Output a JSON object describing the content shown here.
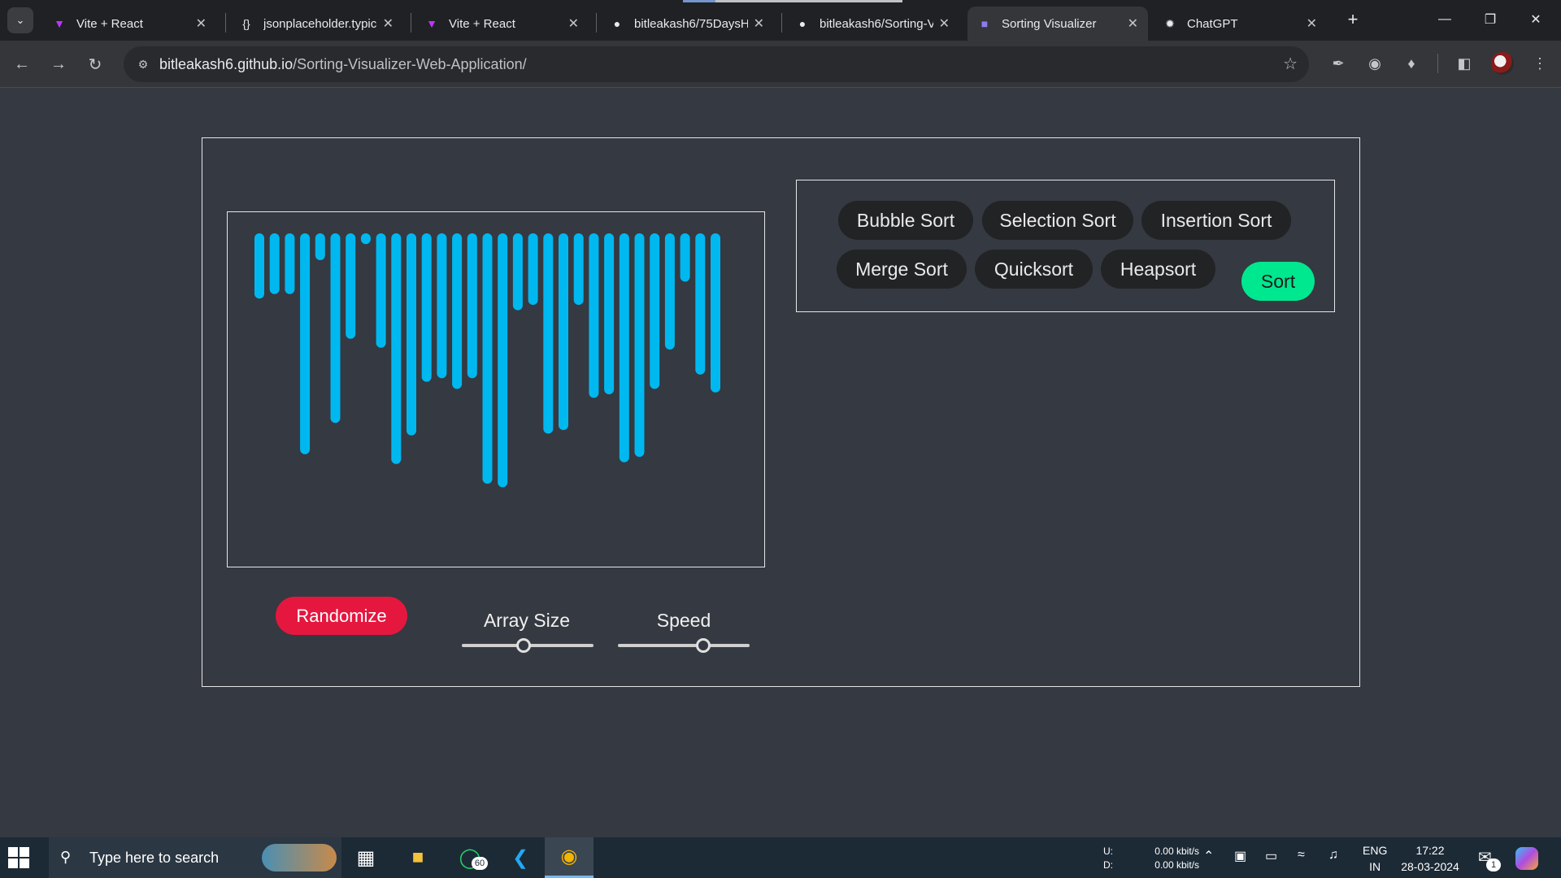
{
  "browser": {
    "tabs": [
      {
        "title": "Vite + React",
        "icon": "vite-icon",
        "active": false
      },
      {
        "title": "jsonplaceholder.typicode.com",
        "icon": "jsonplaceholder-icon",
        "active": false
      },
      {
        "title": "Vite + React",
        "icon": "vite-icon",
        "active": false
      },
      {
        "title": "bitleakash6/75DaysH",
        "icon": "github-icon",
        "active": false
      },
      {
        "title": "bitleakash6/Sorting-V",
        "icon": "github-icon",
        "active": false
      },
      {
        "title": "Sorting Visualizer",
        "icon": "page-icon",
        "active": true
      },
      {
        "title": "ChatGPT",
        "icon": "chatgpt-icon",
        "active": false
      }
    ],
    "url_host": "bitleakash6.github.io",
    "url_path": "/Sorting-Visualizer-Web-Application/"
  },
  "app": {
    "algorithms": [
      {
        "label": "Bubble Sort"
      },
      {
        "label": "Selection Sort"
      },
      {
        "label": "Insertion Sort"
      },
      {
        "label": "Merge Sort"
      },
      {
        "label": "Quicksort"
      },
      {
        "label": "Heapsort"
      }
    ],
    "sort_label": "Sort",
    "randomize_label": "Randomize",
    "array_size_label": "Array Size",
    "speed_label": "Speed",
    "array_size_fraction": 0.47,
    "speed_fraction": 0.65,
    "bar_color": "#00b8f0",
    "array_values": [
      73,
      68,
      68,
      247,
      30,
      212,
      118,
      12,
      128,
      258,
      226,
      166,
      162,
      174,
      162,
      280,
      284,
      86,
      80,
      224,
      220,
      80,
      184,
      180,
      256,
      250,
      174,
      130,
      54,
      158,
      178
    ],
    "sort_button_color": "#00e88f",
    "randomize_button_color": "#e5173f"
  },
  "taskbar": {
    "search_placeholder": "Type here to search",
    "whatsapp_badge": "60",
    "net_up_label": "U:",
    "net_down_label": "D:",
    "net_up": "0.00 kbit/s",
    "net_down": "0.00 kbit/s",
    "lang_top": "ENG",
    "lang_bottom": "IN",
    "time": "17:22",
    "date": "28-03-2024",
    "notification_count": "1"
  }
}
